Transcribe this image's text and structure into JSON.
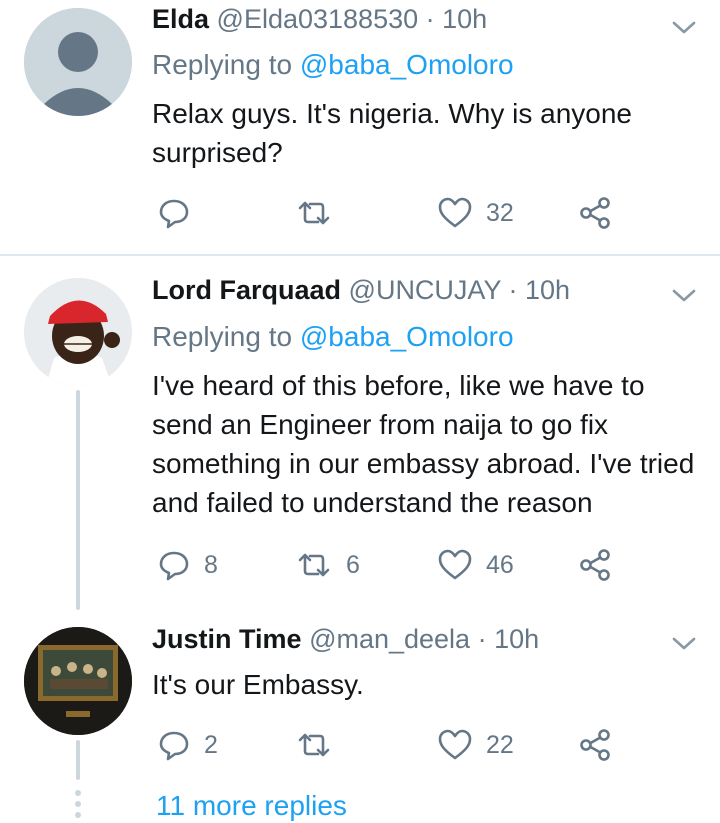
{
  "tweets": [
    {
      "name": "Elda",
      "handle": "@Elda03188530",
      "time": "· 10h",
      "replying_label": "Replying to",
      "replying_to": "@baba_Omoloro",
      "text": "Relax guys. It's nigeria. Why is anyone surprised?",
      "replies": "",
      "retweets": "",
      "likes": "32"
    },
    {
      "name": "Lord Farquaad",
      "handle": "@UNCUJAY",
      "time": "· 10h",
      "replying_label": "Replying to",
      "replying_to": "@baba_Omoloro",
      "text": "I've heard of this before, like we have to send an Engineer from naija to go fix something in our embassy abroad. I've tried and failed to understand the reason",
      "replies": "8",
      "retweets": "6",
      "likes": "46"
    },
    {
      "name": "Justin Time",
      "handle": "@man_deela",
      "time": "· 10h",
      "text": "It's our Embassy.",
      "replies": "2",
      "retweets": "",
      "likes": "22"
    }
  ],
  "more_replies": "11 more replies",
  "icons": {
    "reply": "reply-icon",
    "retweet": "retweet-icon",
    "like": "heart-icon",
    "share": "share-icon",
    "caret": "chevron-down-icon"
  },
  "colors": {
    "link": "#1da1f2",
    "secondary": "#657786",
    "primary_text": "#14171a",
    "divider": "#e1e8ed"
  }
}
